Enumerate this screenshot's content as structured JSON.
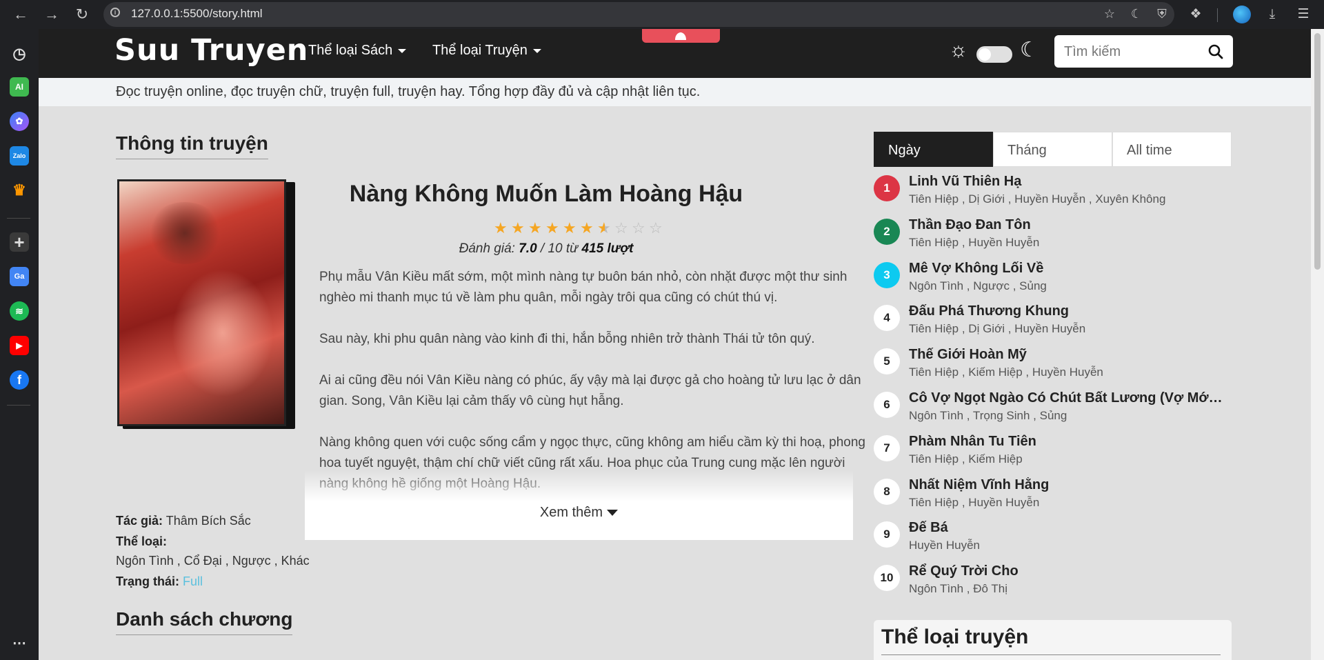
{
  "browser": {
    "url": "127.0.0.1:5500/story.html"
  },
  "site": {
    "logo": "Suu Truyen",
    "menu": [
      {
        "label": "Thể loại Sách"
      },
      {
        "label": "Thể loại Truyện"
      }
    ],
    "search_placeholder": "Tìm kiếm",
    "tagline": "Đọc truyện online, đọc truyện chữ, truyện full, truyện hay. Tổng hợp đầy đủ và cập nhật liên tục."
  },
  "story": {
    "section_title": "Thông tin truyện",
    "title": "Nàng Không Muốn Làm Hoàng Hậu",
    "rating_stars": 7.0,
    "rating_max": 10,
    "rating_label": "Đánh giá:",
    "rating_value": "7.0",
    "rating_sep": "/ 10 từ",
    "rating_votes": "415 lượt",
    "description": [
      "Phụ mẫu Vân Kiều mất sớm, một mình nàng tự buôn bán nhỏ, còn nhặt được một thư sinh nghèo mi thanh mục tú về làm phu quân, mỗi ngày trôi qua cũng có chút thú vị.",
      "Sau này, khi phu quân nàng vào kinh đi thi, hắn bỗng nhiên trở thành Thái tử tôn quý.",
      "Ai ai cũng đều nói Vân Kiều nàng có phúc, ấy vậy mà lại được gả cho hoàng tử lưu lạc ở dân gian. Song, Vân Kiều lại cảm thấy vô cùng hụt hẫng.",
      "Nàng không quen với cuộc sống cẩm y ngọc thực, cũng không am hiểu cầm kỳ thi hoạ, phong hoa tuyết nguyệt, thậm chí chữ viết cũng rất xấu. Hoa phục của Trung cung mặc lên người nàng không hề giống một Hoàng Hậu."
    ],
    "more_label": "Xem thêm",
    "author_label": "Tác giả:",
    "author": "Thâm Bích Sắc",
    "genre_label": "Thể loại:",
    "genres": "Ngôn Tình , Cổ Đại , Ngược , Khác",
    "status_label": "Trạng thái:",
    "status": "Full",
    "chapters_title": "Danh sách chương"
  },
  "ranking": {
    "tabs": [
      {
        "label": "Ngày",
        "active": true
      },
      {
        "label": "Tháng",
        "active": false
      },
      {
        "label": "All time",
        "active": false
      }
    ],
    "items": [
      {
        "num": "1",
        "title": "Linh Vũ Thiên Hạ",
        "genres": "Tiên Hiệp , Dị Giới , Huyền Huyễn , Xuyên Không",
        "color": "#dc3545"
      },
      {
        "num": "2",
        "title": "Thần Đạo Đan Tôn",
        "genres": "Tiên Hiệp , Huyền Huyễn",
        "color": "#198754"
      },
      {
        "num": "3",
        "title": "Mê Vợ Không Lối Về",
        "genres": "Ngôn Tình , Ngược , Sủng",
        "color": "#0dcaf0"
      },
      {
        "num": "4",
        "title": "Đấu Phá Thương Khung",
        "genres": "Tiên Hiệp , Dị Giới , Huyền Huyễn",
        "color": "#ffffff"
      },
      {
        "num": "5",
        "title": "Thế Giới Hoàn Mỹ",
        "genres": "Tiên Hiệp , Kiếm Hiệp , Huyền Huyễn",
        "color": "#ffffff"
      },
      {
        "num": "6",
        "title": "Cô Vợ Ngọt Ngào Có Chút Bất Lương (Vợ Mới Bất Lương Có Chút Ngọt)",
        "genres": "Ngôn Tình , Trọng Sinh , Sủng",
        "color": "#ffffff"
      },
      {
        "num": "7",
        "title": "Phàm Nhân Tu Tiên",
        "genres": "Tiên Hiệp , Kiếm Hiệp",
        "color": "#ffffff"
      },
      {
        "num": "8",
        "title": "Nhất Niệm Vĩnh Hằng",
        "genres": "Tiên Hiệp , Huyền Huyễn",
        "color": "#ffffff"
      },
      {
        "num": "9",
        "title": "Đế Bá",
        "genres": "Huyền Huyễn",
        "color": "#ffffff"
      },
      {
        "num": "10",
        "title": "Rể Quý Trời Cho",
        "genres": "Ngôn Tình , Đô Thị",
        "color": "#ffffff"
      }
    ]
  },
  "categories": {
    "title": "Thể loại truyện"
  },
  "colors": {
    "header_bg": "#1f1f1f",
    "page_bg": "#e0e0e0",
    "star": "#f5a623",
    "status_link": "#5bc0de"
  },
  "icons": [
    "back-icon",
    "forward-icon",
    "reload-icon",
    "info-icon",
    "bookmark-star-icon",
    "moon-icon",
    "shield-icon",
    "extensions-icon",
    "profile-icon",
    "download-icon",
    "menu-icon",
    "history-icon",
    "ai-icon",
    "messenger-icon",
    "zalo-icon",
    "crown-icon",
    "add-icon",
    "translate-icon",
    "spotify-icon",
    "youtube-icon",
    "facebook-icon",
    "more-icon",
    "sun-icon",
    "search-icon"
  ]
}
